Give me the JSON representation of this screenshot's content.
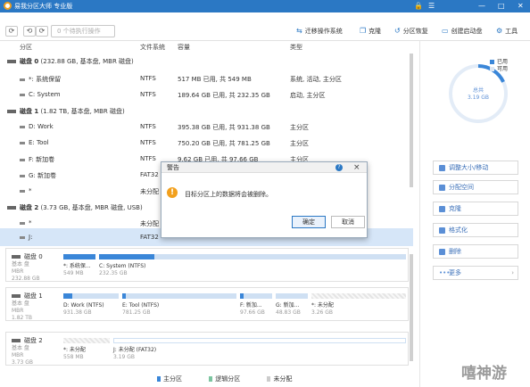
{
  "window": {
    "title": "易我分区大师 专业版",
    "controls": [
      "🔒",
      "☰",
      "—",
      "□",
      "✕"
    ]
  },
  "toolbar": {
    "refresh": "⟳",
    "undo": "⟲",
    "redo": "⟳",
    "apply_label": "0 个待执行操作",
    "items": [
      {
        "icon": "migrate-icon",
        "label": "迁移操作系统"
      },
      {
        "icon": "clone-icon",
        "label": "克隆"
      },
      {
        "icon": "recover-icon",
        "label": "分区恢复"
      },
      {
        "icon": "bootdisk-icon",
        "label": "创建启动盘"
      },
      {
        "icon": "tools-icon",
        "label": "工具"
      }
    ]
  },
  "columns": {
    "partition": "分区",
    "filesystem": "文件系统",
    "capacity": "容量",
    "type": "类型"
  },
  "rows": [
    {
      "kind": "disk",
      "name": "磁盘 0",
      "desc": "(232.88 GB, 基本盘, MBR 磁盘)",
      "fs": "",
      "cap": "",
      "type": ""
    },
    {
      "kind": "part",
      "name": "*: 系统保留",
      "fs": "NTFS",
      "cap": "517 MB   已用, 共   549 MB",
      "type": "系统, 活动, 主分区"
    },
    {
      "kind": "part",
      "name": "C: System",
      "fs": "NTFS",
      "cap": "189.64 GB 已用, 共   232.35 GB",
      "type": "启动, 主分区"
    },
    {
      "kind": "disk",
      "name": "磁盘 1",
      "desc": "(1.82 TB, 基本盘, MBR 磁盘)",
      "fs": "",
      "cap": "",
      "type": ""
    },
    {
      "kind": "part",
      "name": "D: Work",
      "fs": "NTFS",
      "cap": "395.38 GB 已用, 共   931.38 GB",
      "type": "主分区"
    },
    {
      "kind": "part",
      "name": "E: Tool",
      "fs": "NTFS",
      "cap": "750.20 GB 已用, 共   781.25 GB",
      "type": "主分区"
    },
    {
      "kind": "part",
      "name": "F: 新加卷",
      "fs": "NTFS",
      "cap": "9.62 GB   已用, 共   97.66 GB",
      "type": "主分区"
    },
    {
      "kind": "part",
      "name": "G: 新加卷",
      "fs": "FAT32",
      "cap": "",
      "type": ""
    },
    {
      "kind": "part",
      "name": "*",
      "fs": "未分配",
      "cap": "",
      "type": ""
    },
    {
      "kind": "disk",
      "name": "磁盘 2",
      "desc": "(3.73 GB, 基本盘, MBR 磁盘, USB)",
      "fs": "",
      "cap": "",
      "type": ""
    },
    {
      "kind": "part",
      "name": "*",
      "fs": "未分配",
      "cap": "",
      "type": ""
    },
    {
      "kind": "part",
      "name": "J:",
      "fs": "FAT32",
      "cap": "",
      "type": ""
    }
  ],
  "diskmap": [
    {
      "name": "磁盘 0",
      "sub1": "基本 盘",
      "sub2": "MBR",
      "sub3": "232.88 GB",
      "segments": [
        {
          "label": "*: 系统保...",
          "size": "549 MB",
          "kind": "used"
        },
        {
          "label": "C: System (NTFS)",
          "size": "232.35 GB",
          "kind": "used"
        }
      ]
    },
    {
      "name": "磁盘 1",
      "sub1": "基本 盘",
      "sub2": "MBR",
      "sub3": "1.82 TB",
      "segments": [
        {
          "label": "D: Work (NTFS)",
          "size": "931.38 GB",
          "kind": "part"
        },
        {
          "label": "E: Tool (NTFS)",
          "size": "781.25 GB",
          "kind": "part"
        },
        {
          "label": "F: 新加...",
          "size": "97.66 GB",
          "kind": "part"
        },
        {
          "label": "G: 新加...",
          "size": "48.83 GB",
          "kind": "part"
        },
        {
          "label": "*: 未分配",
          "size": "3.26 GB",
          "kind": "free"
        }
      ]
    },
    {
      "name": "磁盘 2",
      "sub1": "基本 盘",
      "sub2": "MBR",
      "sub3": "3.73 GB",
      "segments": [
        {
          "label": "*: 未分配",
          "size": "558 MB",
          "kind": "free"
        },
        {
          "label": "J: 未分配 (FAT32)",
          "size": "3.19 GB",
          "kind": "part"
        }
      ]
    }
  ],
  "legend": {
    "primary": "主分区",
    "logical": "逻辑分区",
    "unalloc": "未分配"
  },
  "right_panel": {
    "donut_legend": [
      "已用",
      "可用"
    ],
    "donut_label": "总共",
    "donut_value": "3.19 GB",
    "used_fraction": 0.18,
    "ops": [
      "调整大小/移动",
      "分配空间",
      "克隆",
      "格式化",
      "删除",
      "更多"
    ]
  },
  "dialog": {
    "title": "警告",
    "message": "目标分区上的数据将会被删除。",
    "ok": "确定",
    "cancel": "取消"
  },
  "watermark": "嘻神游",
  "colors": {
    "accent": "#2b78c4",
    "used": "#3a86d8",
    "selected_row": "#d6e6f8",
    "warning": "#f2a01d"
  }
}
